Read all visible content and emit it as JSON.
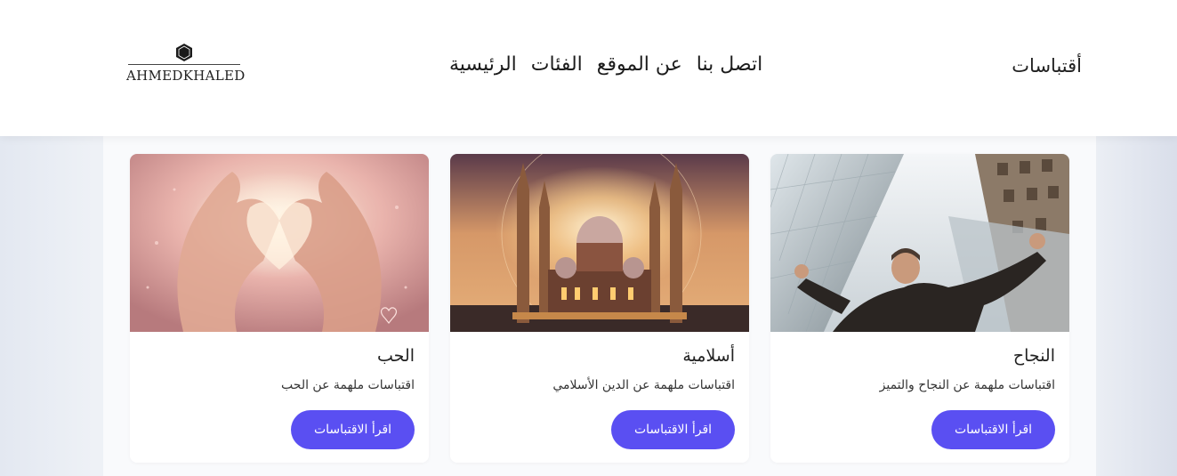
{
  "header": {
    "site_title": "أقتباسات",
    "nav": [
      {
        "label": "الرئيسية"
      },
      {
        "label": "الفئات"
      },
      {
        "label": "عن الموقع"
      },
      {
        "label": "اتصل بنا"
      }
    ],
    "logo_text": "AHMEDKHALED"
  },
  "cards": [
    {
      "title": "النجاح",
      "description": "اقتباسات ملهمة عن النجاح والتميز",
      "button_label": "اقرأ الاقتباسات",
      "image_icon": "success-man-skyscrapers-image"
    },
    {
      "title": "أسلامية",
      "description": "اقتباسات ملهمة عن الدين الأسلامي",
      "button_label": "اقرأ الاقتباسات",
      "image_icon": "mosque-sunset-image"
    },
    {
      "title": "الحب",
      "description": "اقتباسات ملهمة عن الحب",
      "button_label": "اقرأ الاقتباسات",
      "image_icon": "hands-heart-image"
    }
  ],
  "colors": {
    "accent": "#5a4ff2",
    "header_bg": "#ffffff",
    "page_bg": "#f1f3f8"
  }
}
